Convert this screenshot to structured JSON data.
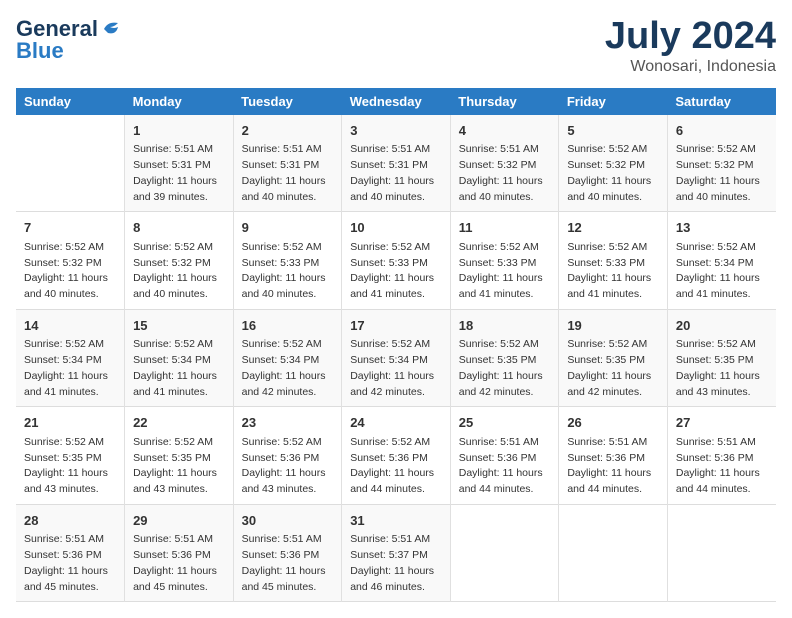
{
  "header": {
    "logo_general": "General",
    "logo_blue": "Blue",
    "month_title": "July 2024",
    "location": "Wonosari, Indonesia"
  },
  "weekdays": [
    "Sunday",
    "Monday",
    "Tuesday",
    "Wednesday",
    "Thursday",
    "Friday",
    "Saturday"
  ],
  "weeks": [
    [
      {
        "day": "",
        "sunrise": "",
        "sunset": "",
        "daylight": ""
      },
      {
        "day": "1",
        "sunrise": "Sunrise: 5:51 AM",
        "sunset": "Sunset: 5:31 PM",
        "daylight": "Daylight: 11 hours and 39 minutes."
      },
      {
        "day": "2",
        "sunrise": "Sunrise: 5:51 AM",
        "sunset": "Sunset: 5:31 PM",
        "daylight": "Daylight: 11 hours and 40 minutes."
      },
      {
        "day": "3",
        "sunrise": "Sunrise: 5:51 AM",
        "sunset": "Sunset: 5:31 PM",
        "daylight": "Daylight: 11 hours and 40 minutes."
      },
      {
        "day": "4",
        "sunrise": "Sunrise: 5:51 AM",
        "sunset": "Sunset: 5:32 PM",
        "daylight": "Daylight: 11 hours and 40 minutes."
      },
      {
        "day": "5",
        "sunrise": "Sunrise: 5:52 AM",
        "sunset": "Sunset: 5:32 PM",
        "daylight": "Daylight: 11 hours and 40 minutes."
      },
      {
        "day": "6",
        "sunrise": "Sunrise: 5:52 AM",
        "sunset": "Sunset: 5:32 PM",
        "daylight": "Daylight: 11 hours and 40 minutes."
      }
    ],
    [
      {
        "day": "7",
        "sunrise": "Sunrise: 5:52 AM",
        "sunset": "Sunset: 5:32 PM",
        "daylight": "Daylight: 11 hours and 40 minutes."
      },
      {
        "day": "8",
        "sunrise": "Sunrise: 5:52 AM",
        "sunset": "Sunset: 5:32 PM",
        "daylight": "Daylight: 11 hours and 40 minutes."
      },
      {
        "day": "9",
        "sunrise": "Sunrise: 5:52 AM",
        "sunset": "Sunset: 5:33 PM",
        "daylight": "Daylight: 11 hours and 40 minutes."
      },
      {
        "day": "10",
        "sunrise": "Sunrise: 5:52 AM",
        "sunset": "Sunset: 5:33 PM",
        "daylight": "Daylight: 11 hours and 41 minutes."
      },
      {
        "day": "11",
        "sunrise": "Sunrise: 5:52 AM",
        "sunset": "Sunset: 5:33 PM",
        "daylight": "Daylight: 11 hours and 41 minutes."
      },
      {
        "day": "12",
        "sunrise": "Sunrise: 5:52 AM",
        "sunset": "Sunset: 5:33 PM",
        "daylight": "Daylight: 11 hours and 41 minutes."
      },
      {
        "day": "13",
        "sunrise": "Sunrise: 5:52 AM",
        "sunset": "Sunset: 5:34 PM",
        "daylight": "Daylight: 11 hours and 41 minutes."
      }
    ],
    [
      {
        "day": "14",
        "sunrise": "Sunrise: 5:52 AM",
        "sunset": "Sunset: 5:34 PM",
        "daylight": "Daylight: 11 hours and 41 minutes."
      },
      {
        "day": "15",
        "sunrise": "Sunrise: 5:52 AM",
        "sunset": "Sunset: 5:34 PM",
        "daylight": "Daylight: 11 hours and 41 minutes."
      },
      {
        "day": "16",
        "sunrise": "Sunrise: 5:52 AM",
        "sunset": "Sunset: 5:34 PM",
        "daylight": "Daylight: 11 hours and 42 minutes."
      },
      {
        "day": "17",
        "sunrise": "Sunrise: 5:52 AM",
        "sunset": "Sunset: 5:34 PM",
        "daylight": "Daylight: 11 hours and 42 minutes."
      },
      {
        "day": "18",
        "sunrise": "Sunrise: 5:52 AM",
        "sunset": "Sunset: 5:35 PM",
        "daylight": "Daylight: 11 hours and 42 minutes."
      },
      {
        "day": "19",
        "sunrise": "Sunrise: 5:52 AM",
        "sunset": "Sunset: 5:35 PM",
        "daylight": "Daylight: 11 hours and 42 minutes."
      },
      {
        "day": "20",
        "sunrise": "Sunrise: 5:52 AM",
        "sunset": "Sunset: 5:35 PM",
        "daylight": "Daylight: 11 hours and 43 minutes."
      }
    ],
    [
      {
        "day": "21",
        "sunrise": "Sunrise: 5:52 AM",
        "sunset": "Sunset: 5:35 PM",
        "daylight": "Daylight: 11 hours and 43 minutes."
      },
      {
        "day": "22",
        "sunrise": "Sunrise: 5:52 AM",
        "sunset": "Sunset: 5:35 PM",
        "daylight": "Daylight: 11 hours and 43 minutes."
      },
      {
        "day": "23",
        "sunrise": "Sunrise: 5:52 AM",
        "sunset": "Sunset: 5:36 PM",
        "daylight": "Daylight: 11 hours and 43 minutes."
      },
      {
        "day": "24",
        "sunrise": "Sunrise: 5:52 AM",
        "sunset": "Sunset: 5:36 PM",
        "daylight": "Daylight: 11 hours and 44 minutes."
      },
      {
        "day": "25",
        "sunrise": "Sunrise: 5:51 AM",
        "sunset": "Sunset: 5:36 PM",
        "daylight": "Daylight: 11 hours and 44 minutes."
      },
      {
        "day": "26",
        "sunrise": "Sunrise: 5:51 AM",
        "sunset": "Sunset: 5:36 PM",
        "daylight": "Daylight: 11 hours and 44 minutes."
      },
      {
        "day": "27",
        "sunrise": "Sunrise: 5:51 AM",
        "sunset": "Sunset: 5:36 PM",
        "daylight": "Daylight: 11 hours and 44 minutes."
      }
    ],
    [
      {
        "day": "28",
        "sunrise": "Sunrise: 5:51 AM",
        "sunset": "Sunset: 5:36 PM",
        "daylight": "Daylight: 11 hours and 45 minutes."
      },
      {
        "day": "29",
        "sunrise": "Sunrise: 5:51 AM",
        "sunset": "Sunset: 5:36 PM",
        "daylight": "Daylight: 11 hours and 45 minutes."
      },
      {
        "day": "30",
        "sunrise": "Sunrise: 5:51 AM",
        "sunset": "Sunset: 5:36 PM",
        "daylight": "Daylight: 11 hours and 45 minutes."
      },
      {
        "day": "31",
        "sunrise": "Sunrise: 5:51 AM",
        "sunset": "Sunset: 5:37 PM",
        "daylight": "Daylight: 11 hours and 46 minutes."
      },
      {
        "day": "",
        "sunrise": "",
        "sunset": "",
        "daylight": ""
      },
      {
        "day": "",
        "sunrise": "",
        "sunset": "",
        "daylight": ""
      },
      {
        "day": "",
        "sunrise": "",
        "sunset": "",
        "daylight": ""
      }
    ]
  ]
}
